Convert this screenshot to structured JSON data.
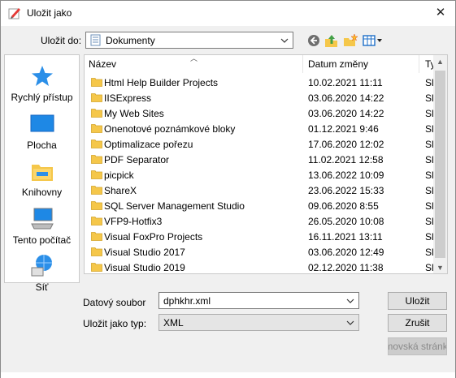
{
  "window": {
    "title": "Uložit jako",
    "close_symbol": "✕"
  },
  "toolbar": {
    "save_in_label": "Uložit do:",
    "save_in_value": "Dokumenty",
    "icons": [
      "back-icon",
      "up-folder-icon",
      "new-folder-icon",
      "view-menu-icon"
    ]
  },
  "places": [
    {
      "label": "Rychlý přístup",
      "icon": "quick-access-star-icon"
    },
    {
      "label": "Plocha",
      "icon": "desktop-icon"
    },
    {
      "label": "Knihovny",
      "icon": "libraries-icon"
    },
    {
      "label": "Tento počítač",
      "icon": "this-pc-icon"
    },
    {
      "label": "Síť",
      "icon": "network-icon"
    }
  ],
  "filelist": {
    "columns": [
      "Název",
      "Datum změny",
      "Ty"
    ],
    "rows": [
      {
        "name": "Html Help Builder Projects",
        "date": "10.02.2021 11:11",
        "type": "Sl"
      },
      {
        "name": "IISExpress",
        "date": "03.06.2020 14:22",
        "type": "Sl"
      },
      {
        "name": "My Web Sites",
        "date": "03.06.2020 14:22",
        "type": "Sl"
      },
      {
        "name": "Onenotové poznámkové bloky",
        "date": "01.12.2021 9:46",
        "type": "Sl"
      },
      {
        "name": "Optimalizace pořezu",
        "date": "17.06.2020 12:02",
        "type": "Sl"
      },
      {
        "name": "PDF Separator",
        "date": "11.02.2021 12:58",
        "type": "Sl"
      },
      {
        "name": "picpick",
        "date": "13.06.2022 10:09",
        "type": "Sl"
      },
      {
        "name": "ShareX",
        "date": "23.06.2022 15:33",
        "type": "Sl"
      },
      {
        "name": "SQL Server Management Studio",
        "date": "09.06.2020 8:55",
        "type": "Sl"
      },
      {
        "name": "VFP9-Hotfix3",
        "date": "26.05.2020 10:08",
        "type": "Sl"
      },
      {
        "name": "Visual FoxPro Projects",
        "date": "16.11.2021 13:11",
        "type": "Sl"
      },
      {
        "name": "Visual Studio 2017",
        "date": "03.06.2020 12:49",
        "type": "Sl"
      },
      {
        "name": "Visual Studio 2019",
        "date": "02.12.2020 11:38",
        "type": "Sl"
      }
    ]
  },
  "form": {
    "filename_label": "Datový soubor",
    "filename_value": "dphkhr.xml",
    "type_label": "Uložit jako typ:",
    "type_value": "XML"
  },
  "buttons": {
    "save": "Uložit",
    "cancel": "Zrušit",
    "homepage": "Domovská stránka"
  },
  "colors": {
    "folder": "#f5c74a",
    "window_bg": "#f0f0f0",
    "accent_blue": "#1e88e5"
  }
}
